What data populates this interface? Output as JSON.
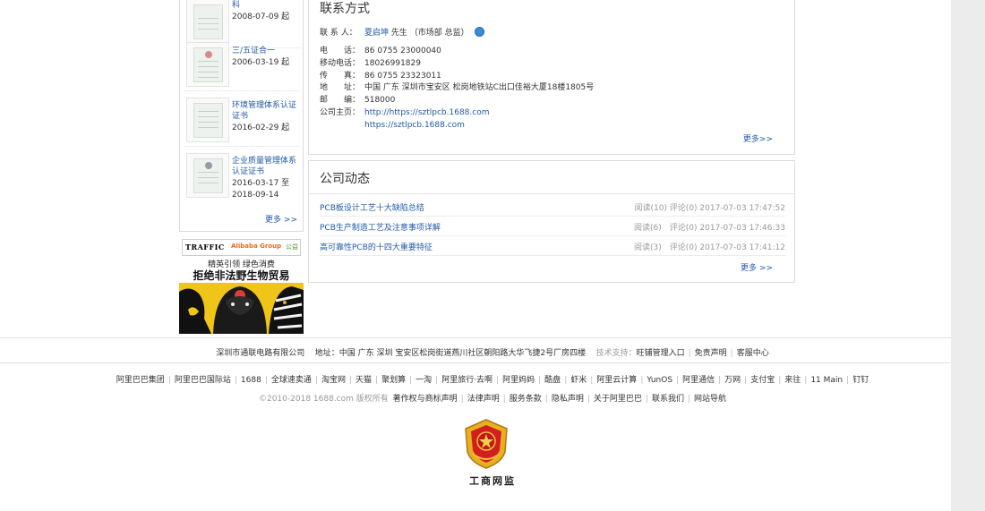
{
  "certificates": [
    {
      "title": "科",
      "date": "2008-07-09 起"
    },
    {
      "title": "三/五证合一",
      "date": "2006-03-19 起"
    },
    {
      "title": "环境管理体系认证证书",
      "date": "2016-02-29 起"
    },
    {
      "title": "企业质量管理体系认证证书",
      "date": "2016-03-17 至",
      "date2": "2018-09-14"
    }
  ],
  "certificates_more": "更多 >>",
  "banner": {
    "logo1": "TRAFFIC",
    "logo2": "Alibaba Group",
    "logo3": "公益",
    "slogan1": "精英引领  绿色消费",
    "slogan2": "拒绝非法野生物贸易"
  },
  "contact": {
    "title": "联系方式",
    "person_label": "联 系 人：",
    "person_name": "夏启坤",
    "person_suffix": "先生 （市场部 总监）",
    "phone_label": "电　　话：",
    "phone": "86 0755 23000040",
    "mobile_label": "移动电话：",
    "mobile": "18026991829",
    "fax_label": "传　　真：",
    "fax": "86 0755 23323011",
    "address_label": "地　　址：",
    "address": "中国 广东 深圳市宝安区 松岗地铁站C出口佳裕大厦18楼1805号",
    "zip_label": "邮　　编：",
    "zip": "518000",
    "homepage_label": "公司主页：",
    "homepage1": "http://https://sztlpcb.1688.com",
    "homepage2": "https://sztlpcb.1688.com",
    "more": "更多>>"
  },
  "news": {
    "title": "公司动态",
    "items": [
      {
        "title": "PCB板设计工艺十大缺陷总结",
        "meta": "阅读(10) 评论(0) 2017-07-03 17:47:52"
      },
      {
        "title": "PCB生产制造工艺及注意事项详解",
        "meta": "阅读(6)　评论(0) 2017-07-03 17:46:33"
      },
      {
        "title": "高可靠性PCB的十四大重要特征",
        "meta": "阅读(3)　评论(0) 2017-07-03 17:41:12"
      }
    ],
    "more": "更多 >>"
  },
  "footer": {
    "company": "深圳市通联电路有限公司",
    "address_label": "地址：",
    "address": "中国 广东 深圳 宝安区松岗街道燕川社区朝阳路大华飞捷2号厂房四楼",
    "tech_label": "技术支持：",
    "tech_links": [
      "旺铺管理入口",
      "免责声明",
      "客服中心"
    ],
    "links": [
      "阿里巴巴集团",
      "阿里巴巴国际站",
      "1688",
      "全球速卖通",
      "淘宝网",
      "天猫",
      "聚划算",
      "一淘",
      "阿里旅行·去啊",
      "阿里妈妈",
      "酷盘",
      "虾米",
      "阿里云计算",
      "YunOS",
      "阿里通信",
      "万网",
      "支付宝",
      "来往",
      "11 Main",
      "钉钉"
    ],
    "copyright": "©2010-2018 1688.com 版权所有",
    "legal_links": [
      "著作权与商标声明",
      "法律声明",
      "服务条款",
      "隐私声明",
      "关于阿里巴巴",
      "联系我们",
      "网站导航"
    ],
    "badge_text": "工商网监"
  }
}
